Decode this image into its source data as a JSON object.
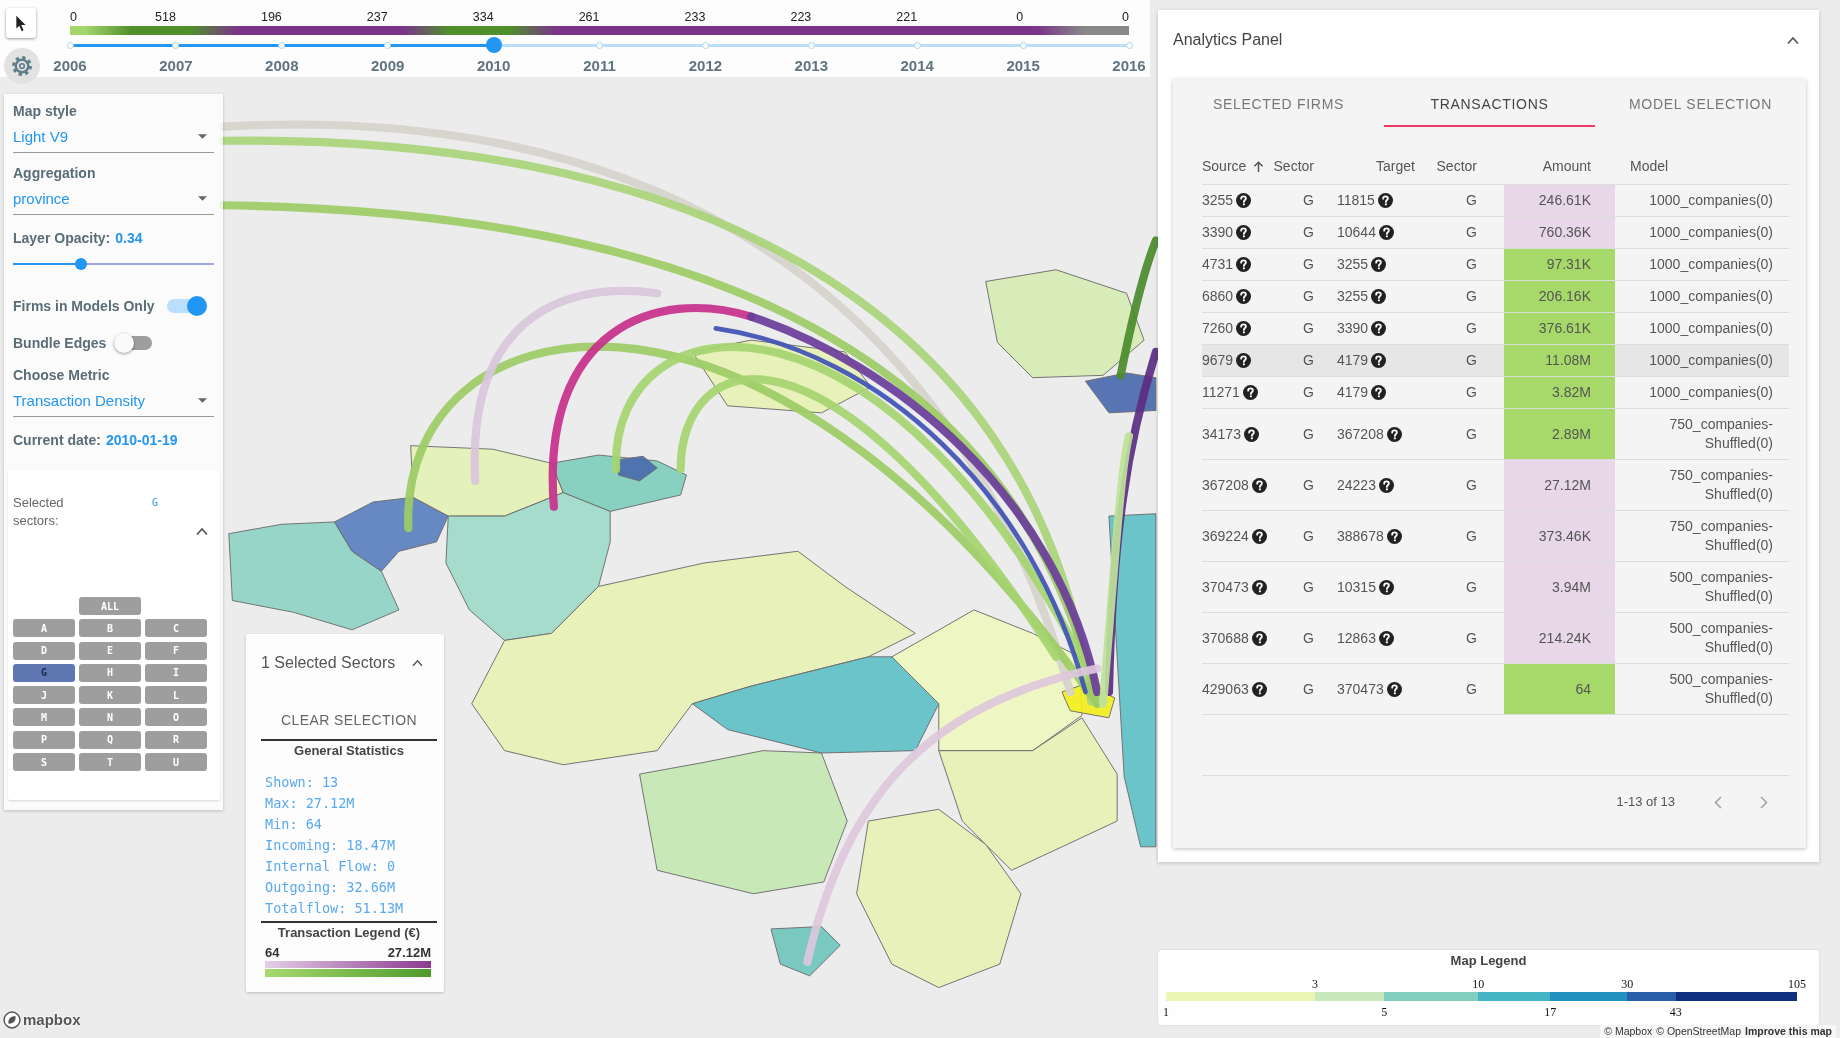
{
  "timeline": {
    "level": 0.4,
    "ticks": [
      {
        "year": "2006",
        "count": "0",
        "color": "#a5d66d"
      },
      {
        "year": "2007",
        "count": "518",
        "color": "#4f8f2c"
      },
      {
        "year": "2008",
        "count": "196",
        "color": "#7a3589"
      },
      {
        "year": "2009",
        "count": "237",
        "color": "#7a3589"
      },
      {
        "year": "2010",
        "count": "334",
        "color": "#4f8f2c"
      },
      {
        "year": "2011",
        "count": "261",
        "color": "#7a3589"
      },
      {
        "year": "2012",
        "count": "233",
        "color": "#7a3589"
      },
      {
        "year": "2013",
        "count": "223",
        "color": "#7a3589"
      },
      {
        "year": "2014",
        "count": "221",
        "color": "#7a3589"
      },
      {
        "year": "2015",
        "count": "0",
        "color": "#7a3589"
      },
      {
        "year": "2016",
        "count": "0",
        "color": "#888888"
      }
    ]
  },
  "sidebar": {
    "controls": [
      {
        "kind": "select",
        "label": "Map style",
        "value": "Light V9"
      },
      {
        "kind": "select",
        "label": "Aggregation",
        "value": "province"
      },
      {
        "kind": "slider",
        "label": "Layer Opacity:",
        "value": "0.34",
        "level": 0.34
      },
      {
        "kind": "toggle",
        "label": "Firms in Models Only",
        "on": true
      },
      {
        "kind": "toggle",
        "label": "Bundle Edges",
        "on": false
      },
      {
        "kind": "select",
        "label": "Choose Metric",
        "value": "Transaction Density"
      },
      {
        "kind": "info",
        "label": "Current date:",
        "value": "2010-01-19"
      }
    ],
    "sectors": {
      "label": "Selected sectors:",
      "value": "G",
      "expanded": true,
      "all_label": "ALL",
      "buttons": [
        {
          "label": "A",
          "selected": false
        },
        {
          "label": "B",
          "selected": false
        },
        {
          "label": "C",
          "selected": false
        },
        {
          "label": "D",
          "selected": false
        },
        {
          "label": "E",
          "selected": false
        },
        {
          "label": "F",
          "selected": false
        },
        {
          "label": "G",
          "selected": true
        },
        {
          "label": "H",
          "selected": false
        },
        {
          "label": "I",
          "selected": false
        },
        {
          "label": "J",
          "selected": false
        },
        {
          "label": "K",
          "selected": false
        },
        {
          "label": "L",
          "selected": false
        },
        {
          "label": "M",
          "selected": false
        },
        {
          "label": "N",
          "selected": false
        },
        {
          "label": "O",
          "selected": false
        },
        {
          "label": "P",
          "selected": false
        },
        {
          "label": "Q",
          "selected": false
        },
        {
          "label": "R",
          "selected": false
        },
        {
          "label": "S",
          "selected": false
        },
        {
          "label": "T",
          "selected": false
        },
        {
          "label": "U",
          "selected": false
        }
      ]
    }
  },
  "sector_panel": {
    "title": "1 Selected Sectors",
    "expanded": true,
    "clear_button": "CLEAR SELECTION",
    "stats_title": "General Statistics",
    "stats": [
      "Shown: 13",
      "Max: 27.12M",
      "Min: 64",
      "Incoming: 18.47M",
      "Internal Flow: 0",
      "Outgoing: 32.66M",
      "Totalflow: 51.13M"
    ],
    "legend_title": "Transaction Legend (€)",
    "legend_min": "64",
    "legend_max": "27.12M"
  },
  "analytics_panel": {
    "title": "Analytics Panel",
    "expanded": true,
    "tabs": [
      {
        "label": "SELECTED FIRMS",
        "selected": false
      },
      {
        "label": "TRANSACTIONS",
        "selected": true
      },
      {
        "label": "MODEL SELECTION",
        "selected": false
      }
    ],
    "table": {
      "columns": [
        {
          "label": "Source",
          "sorted": true
        },
        {
          "label": "Sector",
          "sorted": false
        },
        {
          "label": "Target",
          "sorted": false
        },
        {
          "label": "Sector",
          "sorted": false
        },
        {
          "label": "Amount",
          "sorted": false
        },
        {
          "label": "Model",
          "sorted": false
        }
      ],
      "rows": [
        {
          "source": "3255",
          "source_sector": "G",
          "target": "11815",
          "target_sector": "G",
          "amount": "246.61K",
          "color": "#e8d6e9",
          "model": "1000_companies(0)",
          "selected": false
        },
        {
          "source": "3390",
          "source_sector": "G",
          "target": "10644",
          "target_sector": "G",
          "amount": "760.36K",
          "color": "#e8d6e9",
          "model": "1000_companies(0)",
          "selected": false
        },
        {
          "source": "4731",
          "source_sector": "G",
          "target": "3255",
          "target_sector": "G",
          "amount": "97.31K",
          "color": "#a6d96a",
          "model": "1000_companies(0)",
          "selected": false
        },
        {
          "source": "6860",
          "source_sector": "G",
          "target": "3255",
          "target_sector": "G",
          "amount": "206.16K",
          "color": "#a6d96a",
          "model": "1000_companies(0)",
          "selected": false
        },
        {
          "source": "7260",
          "source_sector": "G",
          "target": "3390",
          "target_sector": "G",
          "amount": "376.61K",
          "color": "#a6d96a",
          "model": "1000_companies(0)",
          "selected": false
        },
        {
          "source": "9679",
          "source_sector": "G",
          "target": "4179",
          "target_sector": "G",
          "amount": "11.08M",
          "color": "#a6d96a",
          "model": "1000_companies(0)",
          "selected": true
        },
        {
          "source": "11271",
          "source_sector": "G",
          "target": "4179",
          "target_sector": "G",
          "amount": "3.82M",
          "color": "#a6d96a",
          "model": "1000_companies(0)",
          "selected": false
        },
        {
          "source": "34173",
          "source_sector": "G",
          "target": "367208",
          "target_sector": "G",
          "amount": "2.89M",
          "color": "#a6d96a",
          "model": "750_companies-Shuffled(0)",
          "selected": false
        },
        {
          "source": "367208",
          "source_sector": "G",
          "target": "24223",
          "target_sector": "G",
          "amount": "27.12M",
          "color": "#e8d6e9",
          "model": "750_companies-Shuffled(0)",
          "selected": false
        },
        {
          "source": "369224",
          "source_sector": "G",
          "target": "388678",
          "target_sector": "G",
          "amount": "373.46K",
          "color": "#e8d6e9",
          "model": "750_companies-Shuffled(0)",
          "selected": false
        },
        {
          "source": "370473",
          "source_sector": "G",
          "target": "10315",
          "target_sector": "G",
          "amount": "3.94M",
          "color": "#e8d6e9",
          "model": "500_companies-Shuffled(0)",
          "selected": false
        },
        {
          "source": "370688",
          "source_sector": "G",
          "target": "12863",
          "target_sector": "G",
          "amount": "214.24K",
          "color": "#e8d6e9",
          "model": "500_companies-Shuffled(0)",
          "selected": false
        },
        {
          "source": "429063",
          "source_sector": "G",
          "target": "370473",
          "target_sector": "G",
          "amount": "64",
          "color": "#a6d96a",
          "model": "500_companies-Shuffled(0)",
          "selected": false
        }
      ]
    },
    "pagination": {
      "range": "1-13 of 13",
      "buttons": [
        {
          "kind": "previous",
          "disabled": true
        },
        {
          "kind": "next",
          "disabled": true
        }
      ]
    }
  },
  "map_legend": {
    "title": "Map Legend",
    "labels": [
      "1",
      "3",
      "5",
      "10",
      "17",
      "30",
      "43",
      "105"
    ],
    "segments": [
      {
        "color": "#ecf6b3"
      },
      {
        "color": "#c8e9bb"
      },
      {
        "color": "#82cfbf"
      },
      {
        "color": "#45b5c5"
      },
      {
        "color": "#2191c0"
      },
      {
        "color": "#285fa8"
      },
      {
        "color": "#10307f"
      }
    ]
  },
  "attribution": {
    "logo": "mapbox",
    "links": [
      "© Mapbox",
      "© OpenStreetMap",
      "Improve this map"
    ]
  }
}
